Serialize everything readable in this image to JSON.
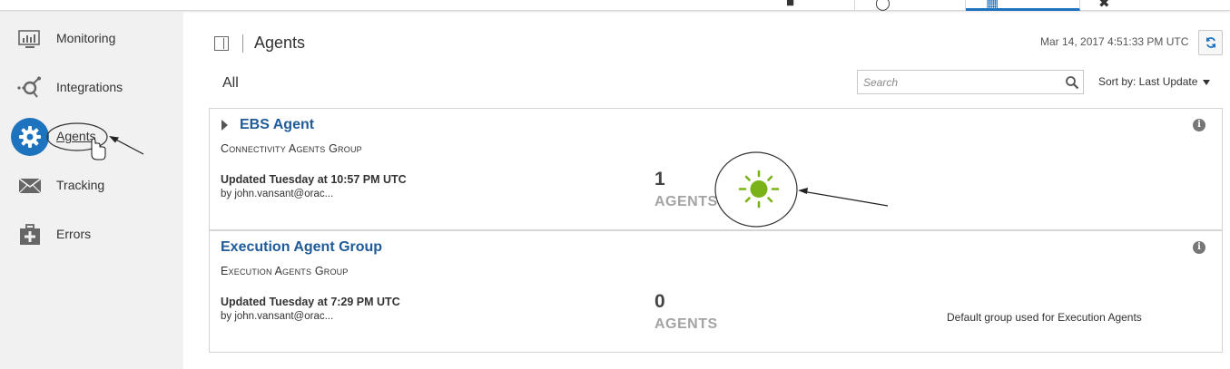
{
  "topbar": {
    "tabs": [
      {
        "icon": "home-icon"
      },
      {
        "icon": "integrations-tab-icon"
      },
      {
        "icon": "calendar-icon",
        "active": true
      },
      {
        "icon": "tools-icon"
      }
    ]
  },
  "sidebar": {
    "items": [
      {
        "label": "Monitoring",
        "icon": "monitor-icon"
      },
      {
        "label": "Integrations",
        "icon": "integrations-icon"
      },
      {
        "label": "Agents",
        "icon": "gear-icon",
        "active": true
      },
      {
        "label": "Tracking",
        "icon": "envelope-icon"
      },
      {
        "label": "Errors",
        "icon": "first-aid-icon"
      }
    ]
  },
  "header": {
    "title": "Agents",
    "timestamp": "Mar 14, 2017 4:51:33 PM UTC",
    "filter_label": "All",
    "search_placeholder": "Search",
    "sort_label": "Sort by: Last Update"
  },
  "cards": [
    {
      "title": "EBS Agent",
      "subtitle": "Connectivity Agents Group",
      "updated": "Updated Tuesday at 10:57 PM UTC",
      "by": "by john.vansant@orac...",
      "count": "1",
      "unit": "AGENTS",
      "status_icon": "sun-icon",
      "status_color": "#7ab317",
      "info": "i"
    },
    {
      "title": "Execution Agent Group",
      "subtitle": "Execution Agents Group",
      "updated": "Updated Tuesday at 7:29 PM UTC",
      "by": "by john.vansant@orac...",
      "count": "0",
      "unit": "AGENTS",
      "description": "Default group used for Execution Agents",
      "info": "i"
    }
  ],
  "colors": {
    "accent": "#1e73be",
    "link": "#1f5b99",
    "sidebar_bg": "#f1f1f1"
  }
}
